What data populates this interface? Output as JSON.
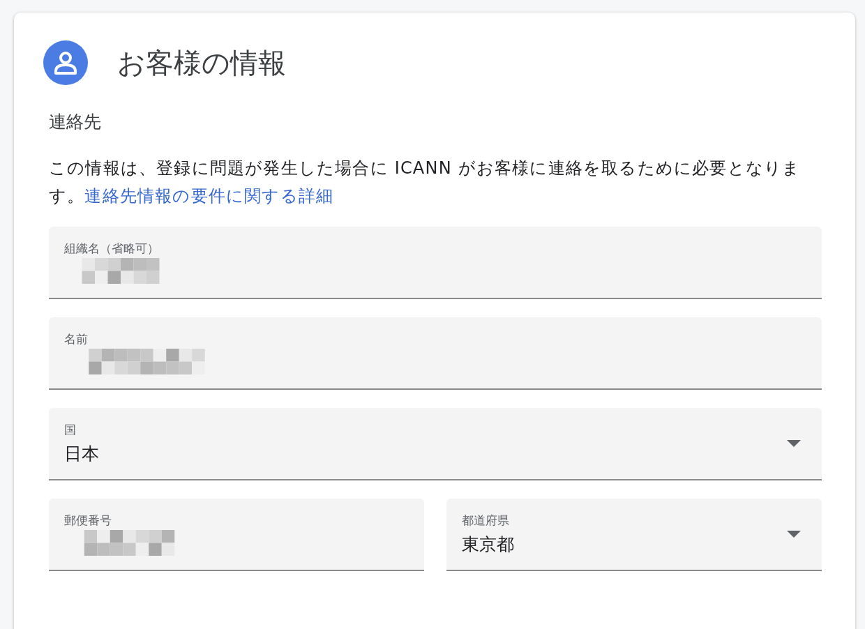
{
  "card": {
    "title": "お客様の情報",
    "section": "連絡先",
    "description": "この情報は、登録に問題が発生した場合に ICANN がお客様に連絡を取るために必要となります。",
    "link": "連絡先情報の要件に関する詳細"
  },
  "rows": [
    [
      {
        "label": "組織名（省略可）",
        "kind": "text",
        "redacted": true
      }
    ],
    [
      {
        "label": "名前",
        "kind": "text",
        "redacted": true
      }
    ],
    [
      {
        "label": "国",
        "kind": "select",
        "value": "日本"
      }
    ],
    [
      {
        "label": "郵便番号",
        "kind": "text",
        "redacted": true
      },
      {
        "label": "都道府県",
        "kind": "select",
        "value": "東京都"
      }
    ]
  ]
}
